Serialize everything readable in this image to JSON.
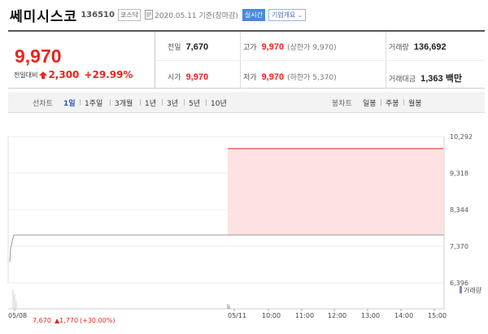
{
  "header": {
    "name": "쎄미시스코",
    "code": "136510",
    "market": "코스닥",
    "asof": "2020.05.11  기준(장마감)",
    "realtime": "실시간",
    "company_info": "기업개요",
    "company_info_chevron": "⌄"
  },
  "price": {
    "current": "9,970",
    "change_label": "전일대비",
    "change": "2,300",
    "change_pct": "+29.99%"
  },
  "stats": {
    "prev_close_label": "전일",
    "prev_close": "7,670",
    "open_label": "시가",
    "open": "9,970",
    "high_label": "고가",
    "high": "9,970",
    "high_note": "(상한가 9,970)",
    "low_label": "저가",
    "low": "9,970",
    "low_note": "(하한가 5,370)",
    "volume_label": "거래량",
    "volume": "136,692",
    "amount_label": "거래대금",
    "amount": "1,363 백만"
  },
  "tabs": {
    "line_chart_label": "선차트",
    "periods": [
      "1일",
      "1주일",
      "3개월",
      "1년",
      "3년",
      "5년",
      "10년"
    ],
    "active_period": "1일",
    "candle_chart_label": "봉차트",
    "candles": [
      "일봉",
      "주봉",
      "월봉"
    ]
  },
  "colors": {
    "up": "#e8251e",
    "accent": "#2a55b5",
    "band": "#fde2e2"
  },
  "chart_data": {
    "type": "line",
    "y_ticks": [
      "10,292",
      "9,318",
      "8,344",
      "7,370",
      "6,396"
    ],
    "ylim": [
      6396,
      10292
    ],
    "x_ticks": [
      "05/08",
      "05/11",
      "10:00",
      "11:00",
      "12:00",
      "13:00",
      "14:00",
      "15:00"
    ],
    "prev_day_line": 7670,
    "today_price": 9970,
    "legend": "거래량",
    "footer": {
      "date": "05/08",
      "price": "7,670",
      "change": "▲1,770",
      "pct": "(+30.00%)"
    }
  }
}
